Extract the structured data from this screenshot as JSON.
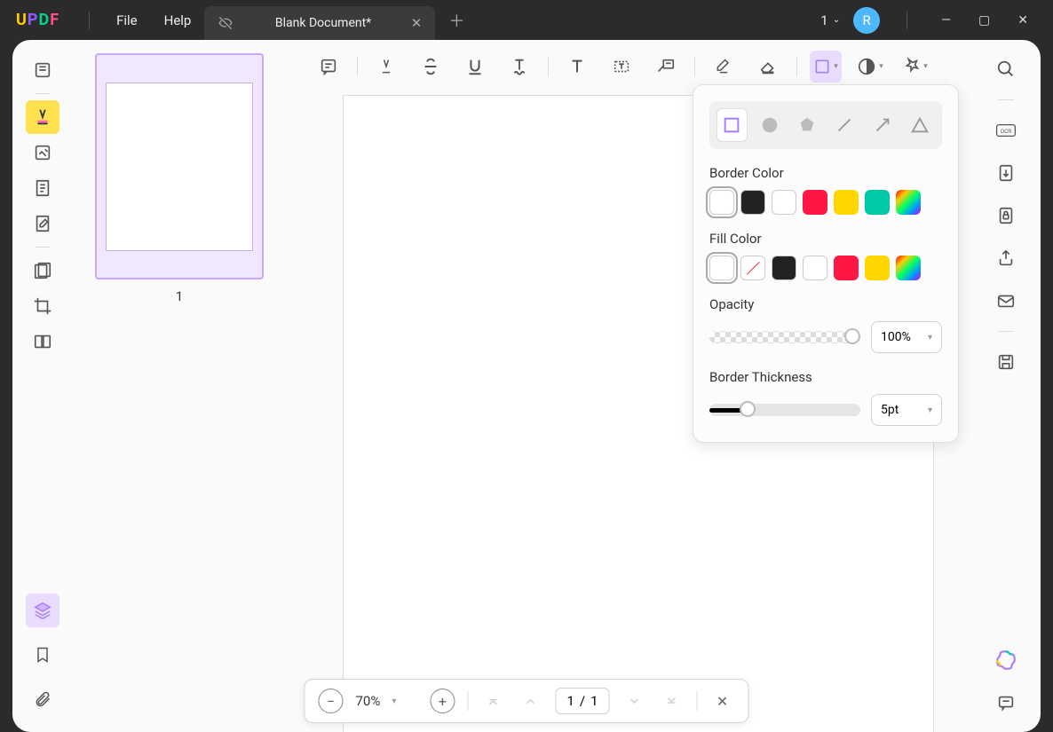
{
  "app": {
    "name": "UPDF"
  },
  "menu": {
    "file": "File",
    "help": "Help"
  },
  "tab": {
    "title": "Blank Document*",
    "doc_count": "1",
    "avatar_initial": "R"
  },
  "thumbnail": {
    "page_number": "1"
  },
  "shape_panel": {
    "border_color_label": "Border Color",
    "fill_color_label": "Fill Color",
    "opacity_label": "Opacity",
    "opacity_value": "100%",
    "thickness_label": "Border Thickness",
    "thickness_value": "5pt",
    "shapes": [
      "rectangle",
      "oval",
      "polygon",
      "line",
      "arrow",
      "triangle"
    ],
    "selected_shape": "rectangle",
    "border_colors": [
      "white",
      "black",
      "white2",
      "red",
      "yellow",
      "cyan",
      "rainbow"
    ],
    "fill_colors": [
      "white",
      "none",
      "black",
      "white2",
      "red",
      "yellow",
      "rainbow"
    ]
  },
  "page_control": {
    "zoom": "70%",
    "current_page": "1",
    "total_pages": "1"
  },
  "colors": {
    "accent_purple": "#a97fff",
    "highlight_yellow": "#ffe14d"
  }
}
